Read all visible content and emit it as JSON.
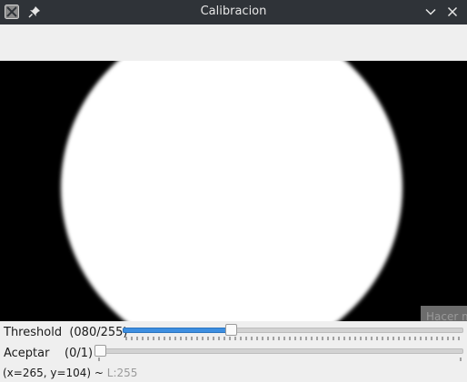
{
  "window": {
    "title": "Calibracion",
    "icons": [
      "app-icon",
      "pin-icon",
      "chevron-down-icon",
      "close-icon"
    ]
  },
  "image_view": {
    "tooltip_text": "Hacer m"
  },
  "trackbars": [
    {
      "name": "Threshold",
      "value_label": "(080/255)",
      "value": 80,
      "max": 255
    },
    {
      "name": "Aceptar",
      "value_label": "(0/1)",
      "value": 0,
      "max": 1
    }
  ],
  "status": {
    "coords": "(x=265, y=104) ~ ",
    "luminance": "L:255"
  },
  "colors": {
    "titlebar": "#2f3338",
    "accent": "#3d8ee0",
    "background": "#efefef"
  }
}
